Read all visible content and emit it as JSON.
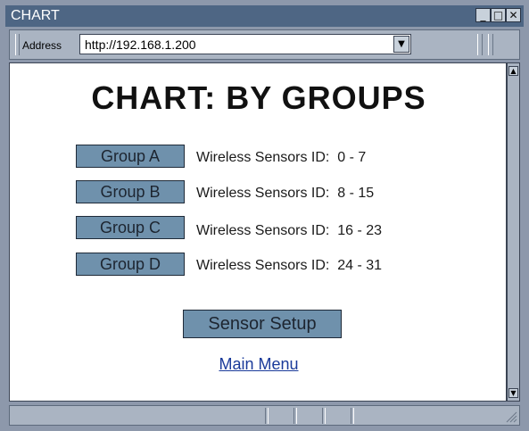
{
  "window": {
    "title": "CHART",
    "controls": {
      "minimize": "_",
      "maximize": "□",
      "close": "✕"
    }
  },
  "address_bar": {
    "label": "Address",
    "url": "http://192.168.1.200",
    "dropdown_icon": "▼"
  },
  "page": {
    "title": "CHART: BY GROUPS",
    "groups": [
      {
        "button": "Group A",
        "label": "Wireless Sensors ID:",
        "range": "0 - 7"
      },
      {
        "button": "Group B",
        "label": "Wireless Sensors ID:",
        "range": "8 - 15"
      },
      {
        "button": "Group C",
        "label": "Wireless Sensors ID:",
        "range": "16 - 23"
      },
      {
        "button": "Group D",
        "label": "Wireless Sensors ID:",
        "range": "24 - 31"
      }
    ],
    "setup_button": "Sensor Setup",
    "main_menu_link": "Main Menu"
  },
  "scrollbar": {
    "up_icon": "▲",
    "down_icon": "▼"
  },
  "colors": {
    "titlebar": "#4e6684",
    "button_fill": "#6f91ac",
    "link": "#1a3a9a",
    "chrome": "#aab4c2"
  }
}
